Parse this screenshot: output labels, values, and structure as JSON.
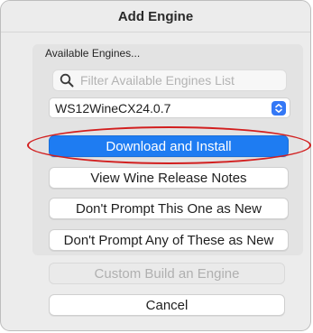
{
  "window": {
    "title": "Add Engine"
  },
  "group": {
    "label": "Available Engines..."
  },
  "search": {
    "placeholder": "Filter Available Engines List",
    "value": "",
    "icon": "search-icon"
  },
  "engine_select": {
    "selected": "WS12WineCX24.0.7",
    "accent": "#3478f6"
  },
  "buttons": {
    "download_install": "Download and Install",
    "release_notes": "View Wine Release Notes",
    "dont_prompt_one": "Don't Prompt This One as New",
    "dont_prompt_any": "Don't Prompt Any of These as New",
    "custom_build": "Custom Build an Engine",
    "cancel": "Cancel"
  },
  "colors": {
    "primary_button": "#1e7cf2",
    "annotation": "#d21f1f"
  }
}
